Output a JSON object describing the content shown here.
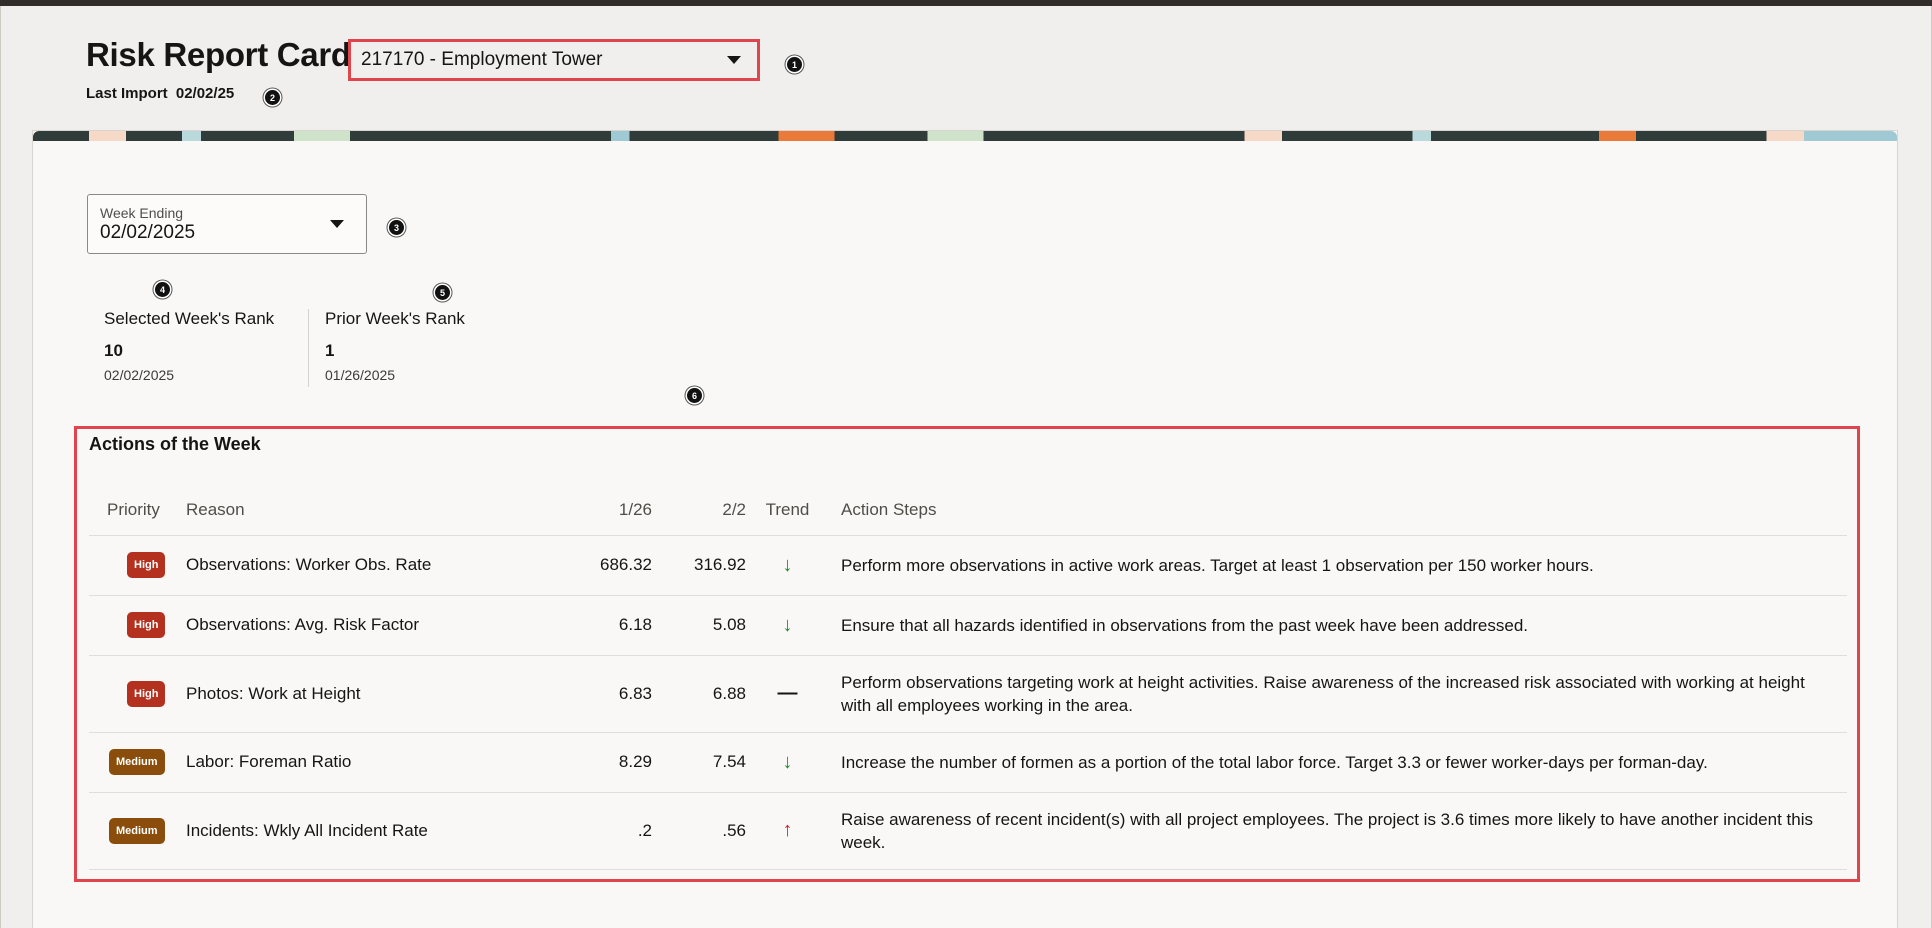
{
  "header": {
    "title": "Risk Report Card",
    "project": "217170 - Employment Tower",
    "last_import_label": "Last Import",
    "last_import_date": "02/02/25"
  },
  "markers": [
    "1",
    "2",
    "3",
    "4",
    "5",
    "6"
  ],
  "week_select": {
    "label": "Week Ending",
    "value": "02/02/2025"
  },
  "ranks": {
    "selected": {
      "label": "Selected Week's Rank",
      "value": "10",
      "date": "02/02/2025"
    },
    "prior": {
      "label": "Prior Week's Rank",
      "value": "1",
      "date": "01/26/2025"
    }
  },
  "actions": {
    "title": "Actions of the Week",
    "columns": {
      "priority": "Priority",
      "reason": "Reason",
      "prev": "1/26",
      "curr": "2/2",
      "trend": "Trend",
      "steps": "Action Steps"
    },
    "rows": [
      {
        "priority": "High",
        "reason": "Observations: Worker Obs. Rate",
        "prev": "686.32",
        "curr": "316.92",
        "trend": "↓",
        "steps": "Perform more observations in active work areas. Target at least 1 observation per 150 worker hours."
      },
      {
        "priority": "High",
        "reason": "Observations: Avg. Risk Factor",
        "prev": "6.18",
        "curr": "5.08",
        "trend": "↓",
        "steps": "Ensure that all hazards identified in observations from the past week have been addressed."
      },
      {
        "priority": "High",
        "reason": "Photos: Work at Height",
        "prev": "6.83",
        "curr": "6.88",
        "trend": "—",
        "steps": "Perform observations targeting work at height activities. Raise awareness of the increased risk associated with working at height with all employees working in the area."
      },
      {
        "priority": "Medium",
        "reason": "Labor: Foreman Ratio",
        "prev": "8.29",
        "curr": "7.54",
        "trend": "↓",
        "steps": "Increase the number of formen as a portion of the total labor force. Target 3.3 or fewer worker-days per forman-day."
      },
      {
        "priority": "Medium",
        "reason": "Incidents: Wkly All Incident Rate",
        "prev": ".2",
        "curr": ".56",
        "trend": "↑",
        "steps": "Raise awareness of recent incident(s) with all project employees. The project is 3.6 times more likely to have another incident this week."
      }
    ]
  }
}
